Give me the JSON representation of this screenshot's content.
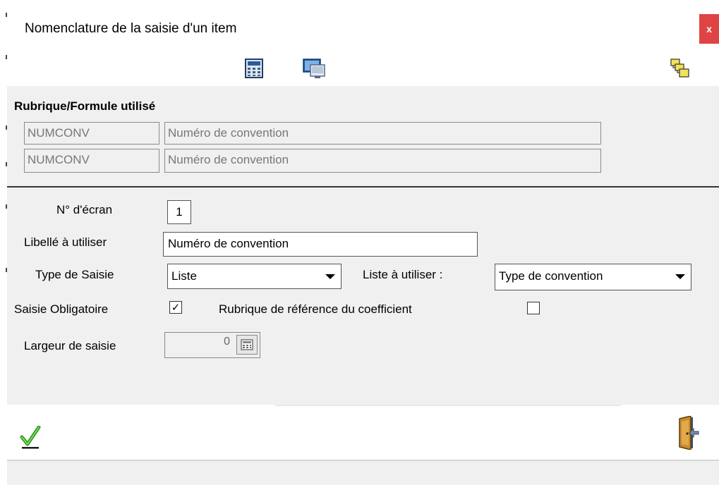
{
  "window": {
    "title": "Nomenclature de la saisie d'un item",
    "close_label": "x"
  },
  "toolbar": {
    "icons": [
      "calculator-icon",
      "monitor-icon",
      "copy-fields-icon"
    ]
  },
  "rubrique": {
    "heading": "Rubrique/Formule utilisé",
    "rows": [
      {
        "code": "NUMCONV",
        "label": "Numéro de convention"
      },
      {
        "code": "NUMCONV",
        "label": "Numéro de convention"
      }
    ]
  },
  "form": {
    "ecran_label": "N° d'écran",
    "ecran_value": "1",
    "libelle_label": "Libellé à utiliser",
    "libelle_value": "Numéro de convention",
    "type_saisie_label": "Type de Saisie",
    "type_saisie_value": "Liste",
    "liste_label": "Liste à utiliser :",
    "liste_value": "Type de convention",
    "obligatoire_label": "Saisie Obligatoire",
    "obligatoire_checked": true,
    "obligatoire_mark": "✓",
    "coefficient_label": "Rubrique de référence du coefficient",
    "coefficient_checked": false,
    "largeur_label": "Largeur de saisie",
    "largeur_value": "0"
  },
  "footer": {
    "icons": [
      "validate-check-icon",
      "exit-door-icon"
    ]
  },
  "colors": {
    "close_button": "#e04343",
    "panel_background": "#f0f0f0",
    "validate_green": "#2e9e1f"
  }
}
